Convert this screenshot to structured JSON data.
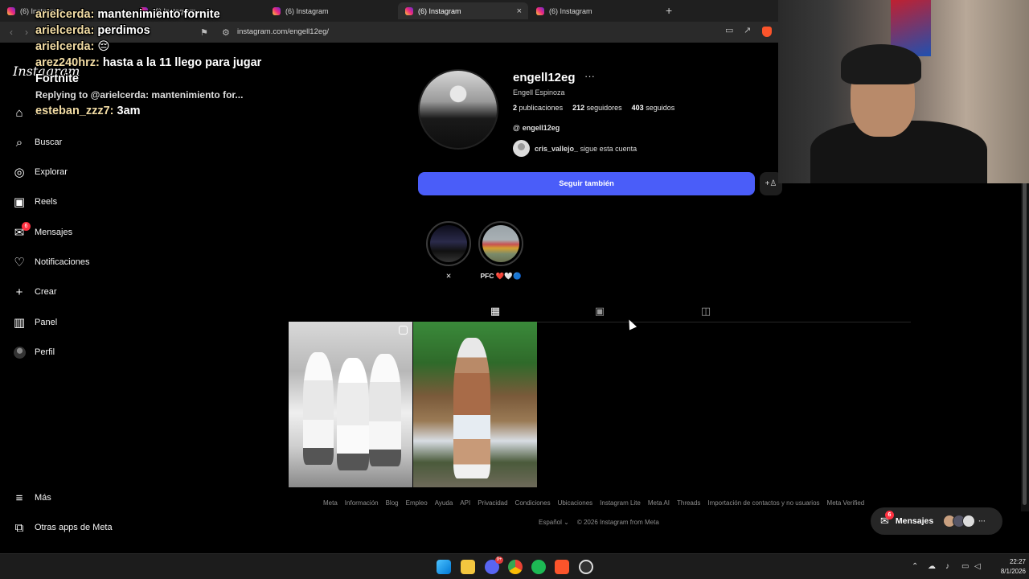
{
  "browser": {
    "tabs": [
      {
        "title": "(6) Instagram",
        "active": false
      },
      {
        "title": "(6) Instagram",
        "active": false
      },
      {
        "title": "(6) Instagram",
        "active": false
      },
      {
        "title": "(6) Instagram",
        "active": true
      },
      {
        "title": "(6) Instagram",
        "active": false
      }
    ],
    "new_tab": "+",
    "tab_close": "×",
    "url": "instagram.com/engell12eg/",
    "accent_color": "#fb542b"
  },
  "sidebar": {
    "logo": "Instagram",
    "items": [
      {
        "label": "Inicio",
        "icon": "home-icon",
        "glyph": "⌂"
      },
      {
        "label": "Buscar",
        "icon": "search-icon",
        "glyph": "⌕"
      },
      {
        "label": "Explorar",
        "icon": "compass-icon",
        "glyph": "◎"
      },
      {
        "label": "Reels",
        "icon": "reels-icon",
        "glyph": "▣"
      },
      {
        "label": "Mensajes",
        "icon": "messenger-icon",
        "glyph": "✉",
        "badge": "6"
      },
      {
        "label": "Notificaciones",
        "icon": "heart-icon",
        "glyph": "♡"
      },
      {
        "label": "Crear",
        "icon": "plus-icon",
        "glyph": "+"
      },
      {
        "label": "Panel",
        "icon": "chart-icon",
        "glyph": "▥"
      },
      {
        "label": "Perfil",
        "icon": "profile-avatar-icon",
        "glyph": ""
      }
    ],
    "bottom_items": [
      {
        "label": "Más",
        "icon": "menu-icon",
        "glyph": "≡"
      },
      {
        "label": "Otras apps de Meta",
        "icon": "meta-apps-icon",
        "glyph": "⧉"
      }
    ]
  },
  "profile": {
    "username": "engell12eg",
    "more": "···",
    "full_name": "Engell Espinoza",
    "stats": {
      "posts_count": "2",
      "posts_label": "publicaciones",
      "followers_count": "212",
      "followers_label": "seguidores",
      "following_count": "403",
      "following_label": "seguidos"
    },
    "threads_handle": "engell12eg",
    "followed_by_user": "cris_vallejo_",
    "followed_by_text": "sigue esta cuenta",
    "follow_button": "Seguir también",
    "follow_button_color": "#4a5df9"
  },
  "highlights": [
    {
      "label": "✕"
    },
    {
      "label": "PFC ❤️🤍🔵"
    }
  ],
  "profile_tabs": [
    {
      "icon": "grid-icon",
      "glyph": "▦",
      "active": true
    },
    {
      "icon": "reels-tab-icon",
      "glyph": "▣",
      "active": false
    },
    {
      "icon": "tagged-icon",
      "glyph": "◫",
      "active": false
    }
  ],
  "footer": {
    "links": [
      "Meta",
      "Información",
      "Blog",
      "Empleo",
      "Ayuda",
      "API",
      "Privacidad",
      "Condiciones",
      "Ubicaciones",
      "Instagram Lite",
      "Meta AI",
      "Threads",
      "Importación de contactos y no usuarios",
      "Meta Verified"
    ],
    "language": "Español",
    "copyright": "© 2026 Instagram from Meta"
  },
  "messages_pill": {
    "label": "Mensajes",
    "badge": "6",
    "more": "···"
  },
  "chat_overlay": [
    {
      "user": "arielcerda:",
      "text": " mantenimiento fornite"
    },
    {
      "user": "arielcerda:",
      "text": " perdimos"
    },
    {
      "user": "arielcerda:",
      "text": " 😔"
    },
    {
      "user": "arez240hrz:",
      "text": " hasta a la 11 llego para jugar Fortnite"
    },
    {
      "user": "",
      "text": "Replying to @arielcerda: mantenimiento for..."
    },
    {
      "user": "esteban_zzz7:",
      "text": " 3am"
    }
  ],
  "taskbar": {
    "time": "22:27",
    "date": "8/1/2026",
    "discord_badge": "9+"
  }
}
